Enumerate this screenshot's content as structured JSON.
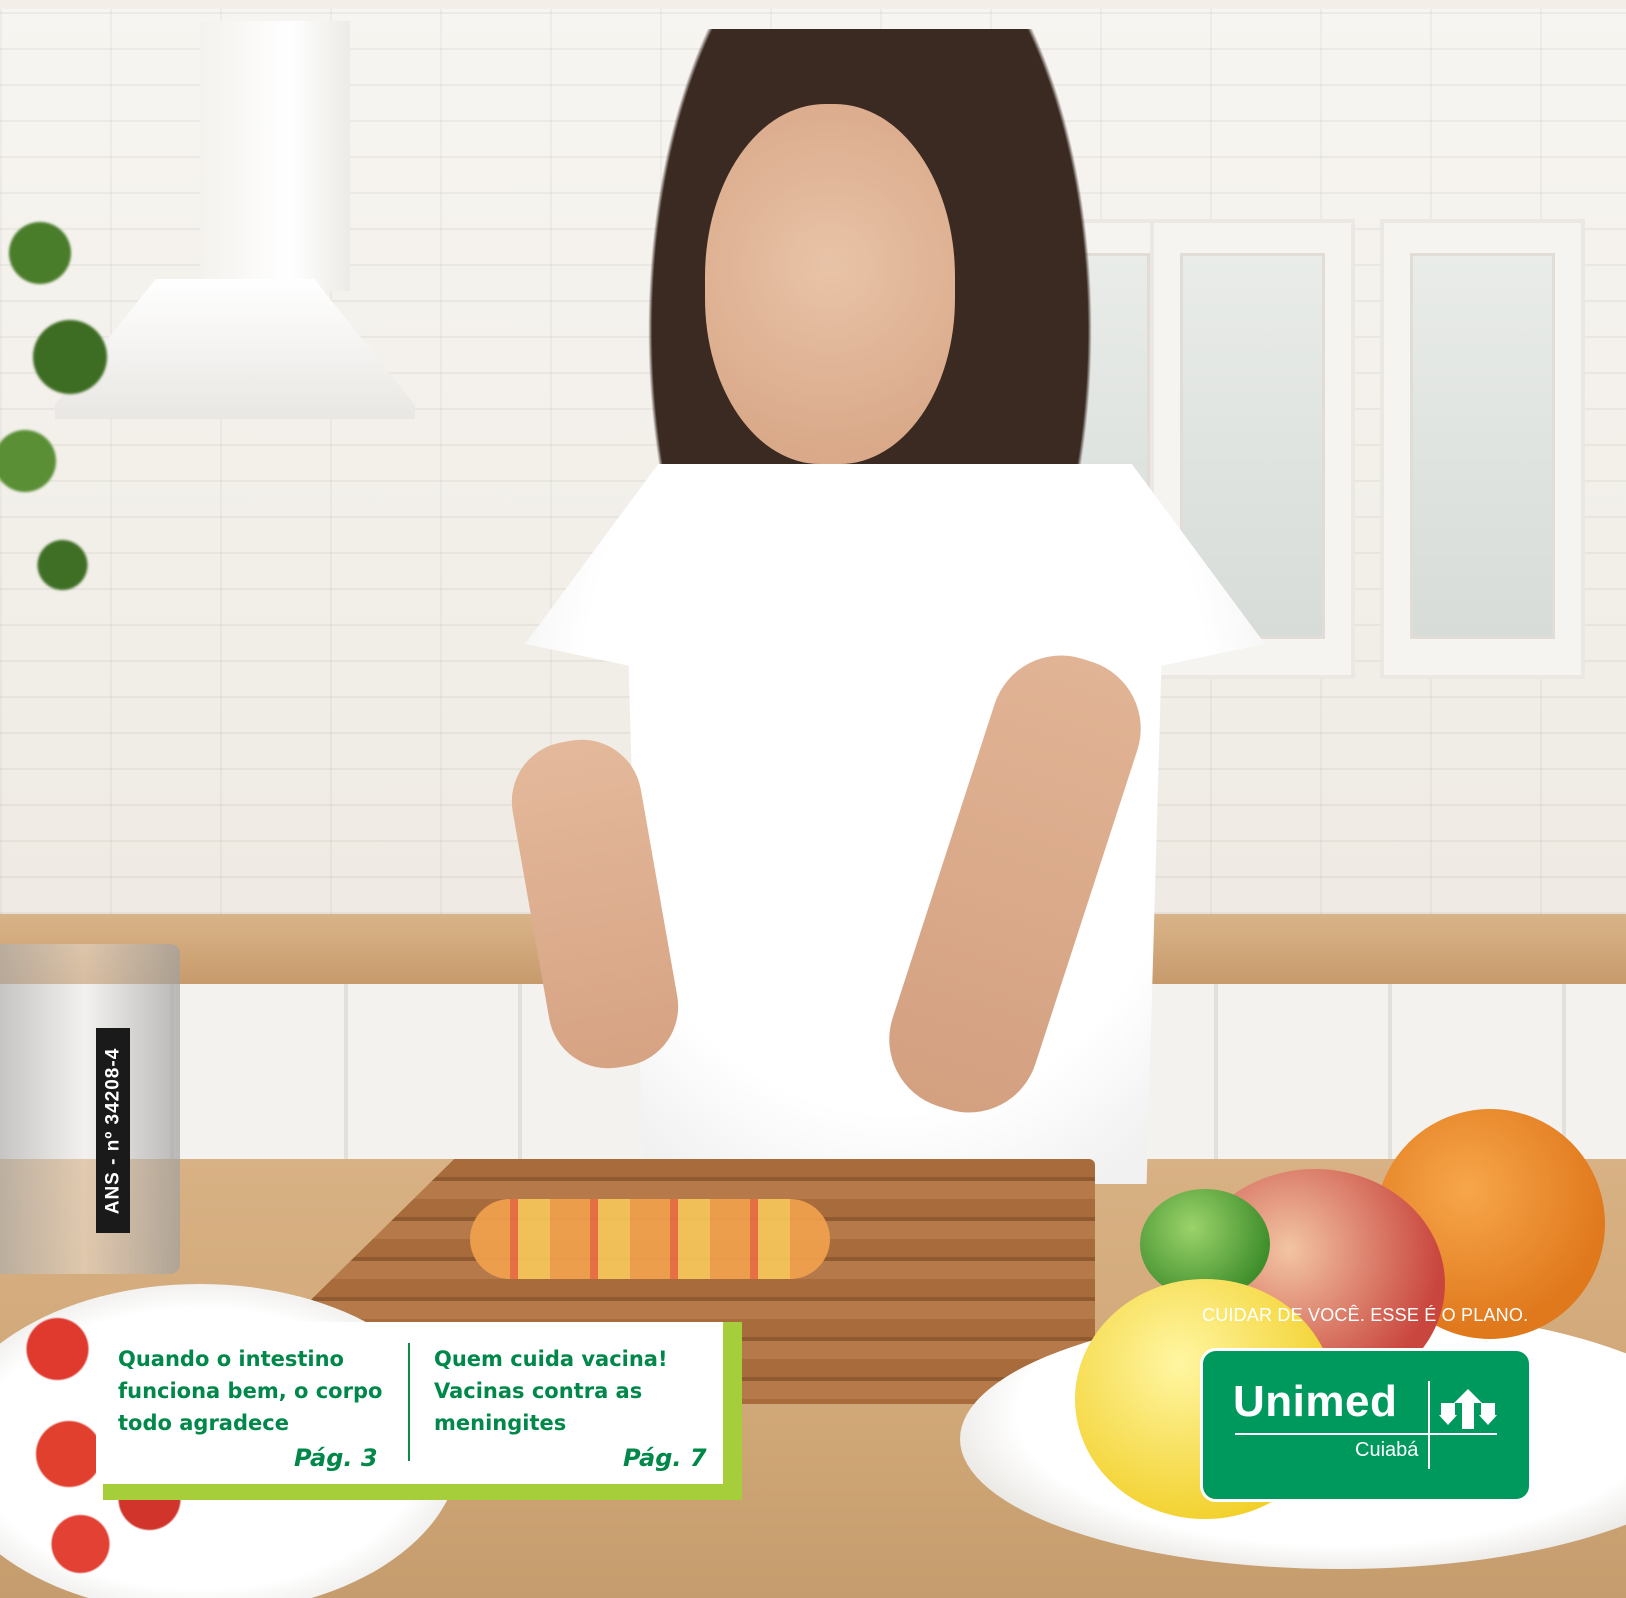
{
  "document": {
    "ans_registration": "ANS - nº 34208-4",
    "teasers": [
      {
        "title": "Quando o intestino\nfunciona bem, o corpo\ntodo agradece",
        "page": "Pág. 3"
      },
      {
        "title": "Quem cuida vacina!\nVacinas contra as\nmeningites",
        "page": "Pág. 7"
      }
    ],
    "slogan": "CUIDAR DE VOCÊ. ESSE É O PLANO.",
    "logo": {
      "brand": "Unimed",
      "city": "Cuiabá",
      "icon": "unimed-emblem-icon"
    }
  },
  "colors": {
    "brand_green": "#00995d",
    "text_green": "#00884a",
    "accent_lime": "#a6cd3a",
    "tag_black": "#1a1a1a"
  }
}
